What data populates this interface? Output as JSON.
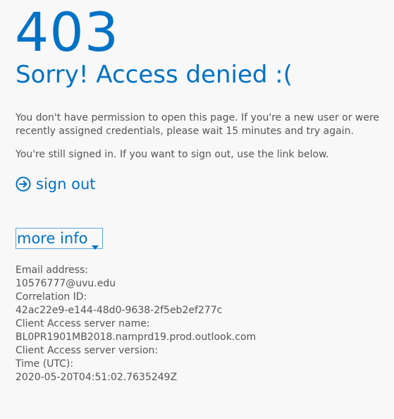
{
  "error": {
    "code": "403",
    "headline": "Sorry! Access denied :(",
    "message": "You don't have permission to open this page. If you're a new user or were recently assigned credentials, please wait 15 minutes and try again.",
    "signed_in_note": "You're still signed in. If you want to sign out, use the link below."
  },
  "actions": {
    "sign_out_label": "sign out",
    "more_info_label": "more info",
    "sign_out_icon": "arrow-right-circle-icon",
    "more_info_icon": "caret-down-icon"
  },
  "details": {
    "email_label": "Email address:",
    "email_value": "10576777@uvu.edu",
    "correlation_label": "Correlation ID:",
    "correlation_value": "42ac22e9-e144-48d0-9638-2f5eb2ef277c",
    "server_name_label": "Client Access server name:",
    "server_name_value": "BL0PR1901MB2018.namprd19.prod.outlook.com",
    "server_version_label": "Client Access server version:",
    "time_label": "Time (UTC):",
    "time_value": "2020-05-20T04:51:02.7635249Z"
  },
  "colors": {
    "accent": "#0072c6",
    "text": "#555555",
    "background": "#f8f8f8",
    "border": "#5aa6e0"
  }
}
